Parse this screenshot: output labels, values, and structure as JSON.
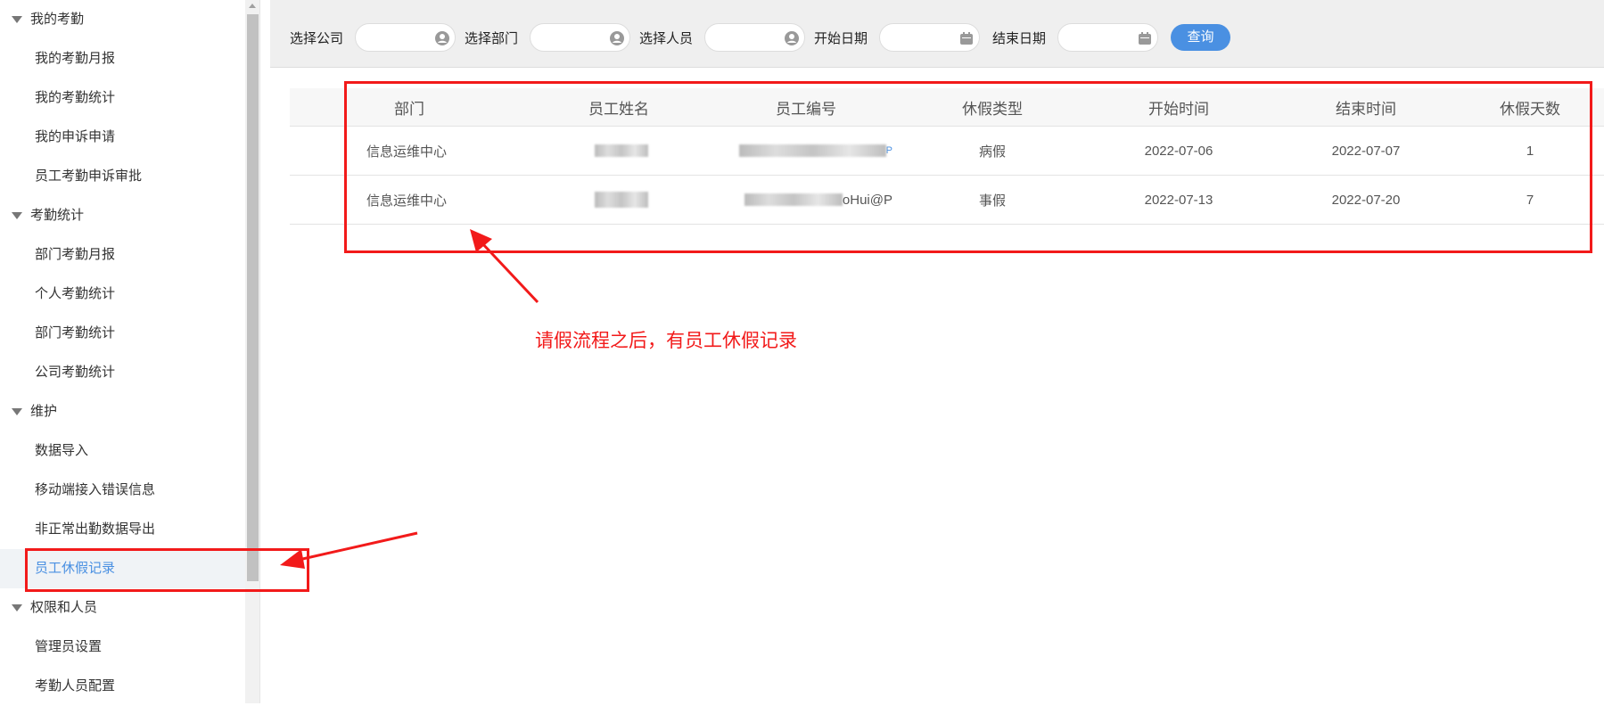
{
  "sidebar": {
    "items": [
      {
        "label": "我的考勤",
        "type": "group"
      },
      {
        "label": "我的考勤月报"
      },
      {
        "label": "我的考勤统计"
      },
      {
        "label": "我的申诉申请"
      },
      {
        "label": "员工考勤申诉审批"
      },
      {
        "label": "考勤统计",
        "type": "group"
      },
      {
        "label": "部门考勤月报"
      },
      {
        "label": "个人考勤统计"
      },
      {
        "label": "部门考勤统计"
      },
      {
        "label": "公司考勤统计"
      },
      {
        "label": "维护",
        "type": "group"
      },
      {
        "label": "数据导入"
      },
      {
        "label": "移动端接入错误信息"
      },
      {
        "label": "非正常出勤数据导出"
      },
      {
        "label": "员工休假记录",
        "active": true
      },
      {
        "label": "权限和人员",
        "type": "group"
      },
      {
        "label": "管理员设置"
      },
      {
        "label": "考勤人员配置"
      }
    ]
  },
  "filters": {
    "company_label": "选择公司",
    "company_value": "",
    "dept_label": "选择部门",
    "dept_value": "",
    "person_label": "选择人员",
    "person_value": "",
    "start_label": "开始日期",
    "start_value": "",
    "end_label": "结束日期",
    "end_value": "",
    "query_label": "查询"
  },
  "table": {
    "headers": [
      "部门",
      "员工姓名",
      "员工编号",
      "休假类型",
      "开始时间",
      "结束时间",
      "休假天数"
    ],
    "rows": [
      {
        "dept": "信息运维中心",
        "name": "",
        "id": "P",
        "type": "病假",
        "start": "2022-07-06",
        "end": "2022-07-07",
        "days": "1"
      },
      {
        "dept": "信息运维中心",
        "name": "",
        "id": "oHui@P",
        "type": "事假",
        "start": "2022-07-13",
        "end": "2022-07-20",
        "days": "7"
      }
    ]
  },
  "annotation": {
    "text": "请假流程之后，有员工休假记录",
    "color": "#f21a1a"
  },
  "colors": {
    "accent": "#4a90e2"
  }
}
